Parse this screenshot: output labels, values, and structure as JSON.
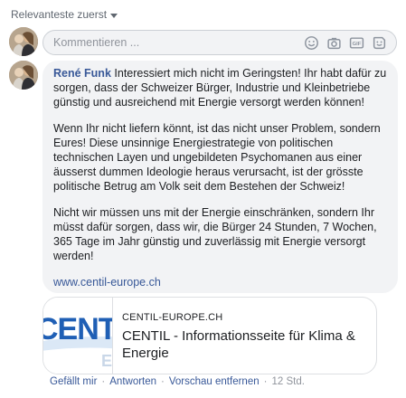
{
  "sort": {
    "label": "Relevanteste zuerst"
  },
  "composer": {
    "placeholder": "Kommentieren ...",
    "icons": [
      "emoji-icon",
      "camera-icon",
      "gif-icon",
      "sticker-icon"
    ],
    "gif_label": "GIF"
  },
  "comment": {
    "author": "René Funk",
    "paragraphs": [
      "Interessiert mich nicht im Geringsten! Ihr habt dafür zu sorgen, dass der Schweizer Bürger, Industrie und Kleinbetriebe günstig und ausreichend mit Energie versorgt werden können!",
      "Wenn Ihr nicht liefern könnt, ist das nicht unser Problem, sondern Eures! Diese unsinnige Energiestrategie von politischen technischen Layen und ungebildeten Psychomanen aus einer äusserst dummen Ideologie heraus verursacht, ist der grösste politische Betrug am Volk seit dem Bestehen der Schweiz!",
      "Nicht wir müssen uns mit der Energie einschränken, sondern Ihr müsst dafür sorgen, dass wir, die Bürger 24 Stunden, 7 Wochen, 365 Tage im Jahr günstig und zuverlässig mit Energie versorgt werden!"
    ],
    "link": "www.centil-europe.ch"
  },
  "preview": {
    "logo_text": "CENTIL",
    "domain": "CENTIL-EUROPE.CH",
    "title": "CENTIL - Informationsseite für Klima & Energie"
  },
  "actions": {
    "like": "Gefällt mir",
    "reply": "Antworten",
    "remove_preview": "Vorschau entfernen",
    "time": "12 Std."
  },
  "colors": {
    "link": "#385898",
    "bubble": "#f2f3f5",
    "muted": "#90949c",
    "logo_blue": "#1f5fb5"
  }
}
